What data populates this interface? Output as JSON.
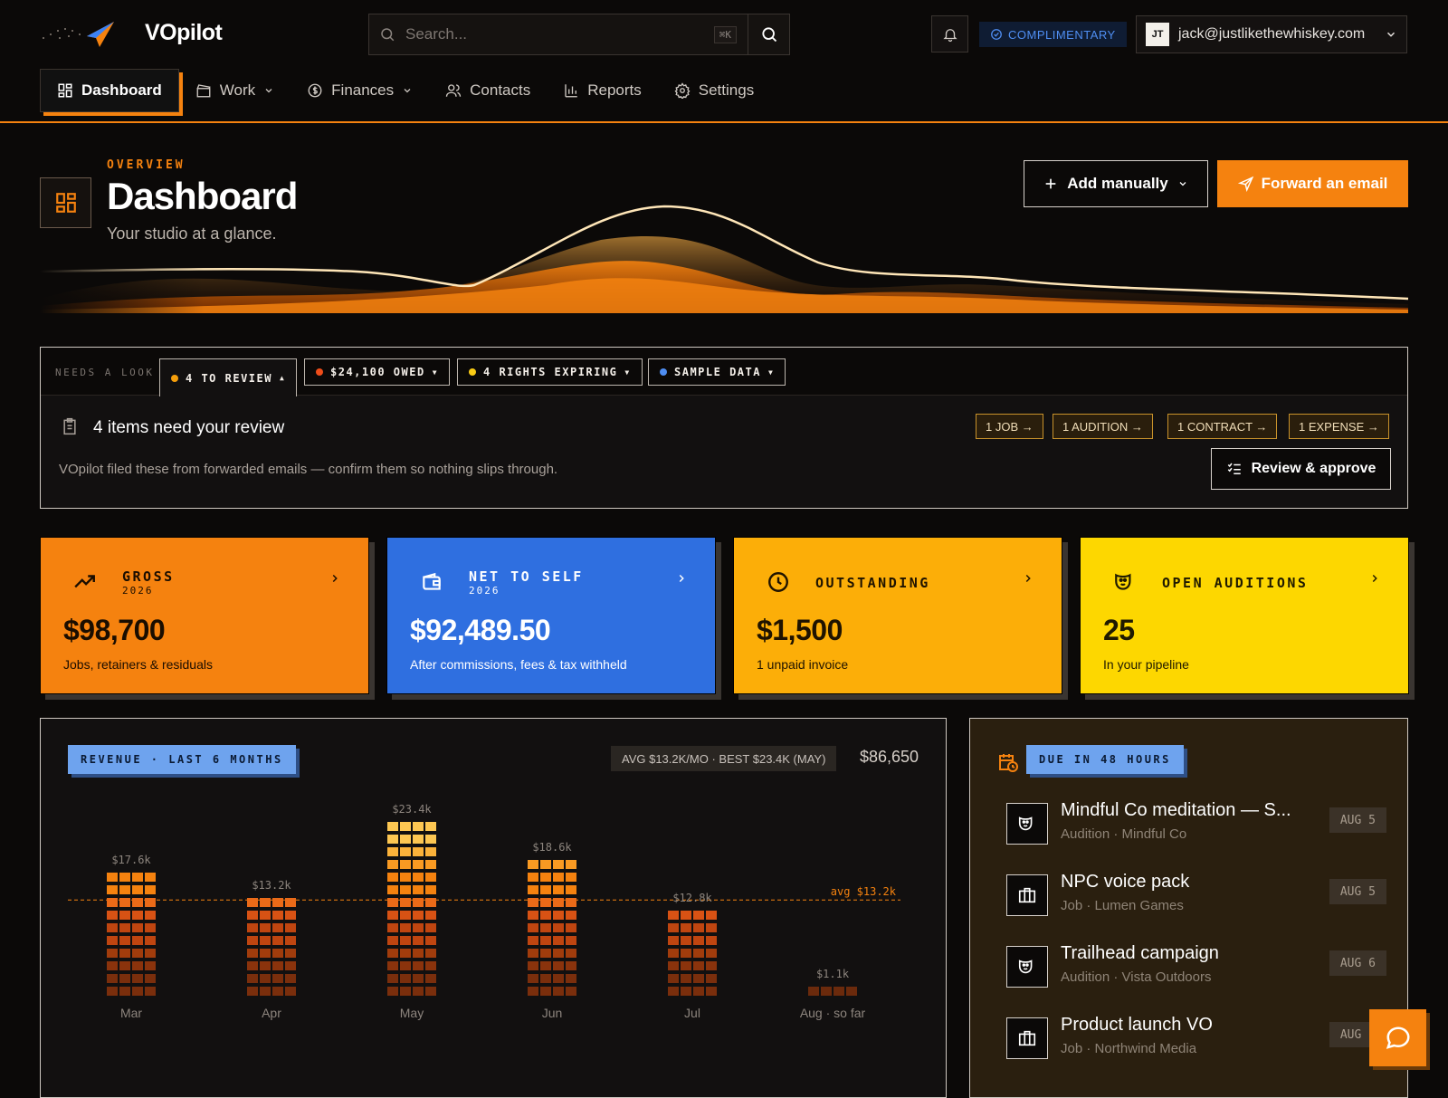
{
  "app": {
    "brand": "VOpilot"
  },
  "search": {
    "placeholder": "Search...",
    "shortcut": "⌘K"
  },
  "plan": {
    "label": "COMPLIMENTARY"
  },
  "user": {
    "initials": "JT",
    "email": "jack@justlikethewhiskey.com"
  },
  "nav": {
    "items": [
      {
        "label": "Dashboard",
        "icon": "grid-icon",
        "active": true
      },
      {
        "label": "Work",
        "icon": "clapper-icon",
        "dropdown": true
      },
      {
        "label": "Finances",
        "icon": "dollar-icon",
        "dropdown": true
      },
      {
        "label": "Contacts",
        "icon": "users-icon"
      },
      {
        "label": "Reports",
        "icon": "bar-chart-icon"
      },
      {
        "label": "Settings",
        "icon": "gear-icon"
      }
    ]
  },
  "hero": {
    "eyebrow": "OVERVIEW",
    "title": "Dashboard",
    "subtitle": "Your studio at a glance.",
    "add_label": "Add manually",
    "forward_label": "Forward an email"
  },
  "needs_look": {
    "label": "NEEDS A LOOK",
    "chips": [
      {
        "label": "4 TO REVIEW",
        "color": "#f59e0b",
        "active": true
      },
      {
        "label": "$24,100 OWED",
        "color": "#ef4d1a"
      },
      {
        "label": "4 RIGHTS EXPIRING",
        "color": "#facc15"
      },
      {
        "label": "SAMPLE DATA",
        "color": "#4f8ef2"
      }
    ],
    "title": "4 items need your review",
    "description": "VOpilot filed these from forwarded emails — confirm them so nothing slips through.",
    "tags": [
      "1 JOB →",
      "1 AUDITION →",
      "1 CONTRACT →",
      "1 EXPENSE →"
    ],
    "approve_label": "Review & approve"
  },
  "stats": [
    {
      "label": "GROSS",
      "year": "2026",
      "value": "$98,700",
      "note": "Jobs, retainers & residuals",
      "bg": "#f5820f",
      "fg": "#1a0d00",
      "icon": "trend-up-icon"
    },
    {
      "label": "NET TO SELF",
      "year": "2026",
      "value": "$92,489.50",
      "note": "After commissions, fees & tax withheld",
      "bg": "#2f6fe0",
      "fg": "#ffffff",
      "icon": "wallet-icon"
    },
    {
      "label": "OUTSTANDING",
      "year": "",
      "value": "$1,500",
      "note": "1 unpaid invoice",
      "bg": "#fcae08",
      "fg": "#1f1300",
      "icon": "clock-icon"
    },
    {
      "label": "OPEN AUDITIONS",
      "year": "",
      "value": "25",
      "note": "In your pipeline",
      "bg": "#fdd700",
      "fg": "#1f1a00",
      "icon": "masks-icon"
    }
  ],
  "revenue": {
    "badge": "REVENUE · LAST 6 MONTHS",
    "summary": "AVG $13.2K/MO · BEST $23.4K (MAY)",
    "total": "$86,650",
    "avg_label": "avg $13.2k"
  },
  "chart_data": {
    "type": "bar",
    "title": "REVENUE · LAST 6 MONTHS",
    "categories": [
      "Mar",
      "Apr",
      "May",
      "Jun",
      "Jul",
      "Aug · so far"
    ],
    "values": [
      17.6,
      13.2,
      23.4,
      18.6,
      12.8,
      1.1
    ],
    "value_labels": [
      "$17.6k",
      "$13.2k",
      "$23.4k",
      "$18.6k",
      "$12.8k",
      "$1.1k"
    ],
    "average": 13.2,
    "unit": "$k",
    "ylim": [
      0,
      24
    ]
  },
  "due": {
    "badge": "DUE IN 48 HOURS",
    "items": [
      {
        "title": "Mindful Co meditation — S...",
        "sub": "Audition · Mindful Co",
        "date": "AUG 5",
        "icon": "masks-icon"
      },
      {
        "title": "NPC voice pack",
        "sub": "Job · Lumen Games",
        "date": "AUG 5",
        "icon": "briefcase-icon"
      },
      {
        "title": "Trailhead campaign",
        "sub": "Audition · Vista Outdoors",
        "date": "AUG 6",
        "icon": "masks-icon"
      },
      {
        "title": "Product launch VO",
        "sub": "Job · Northwind Media",
        "date": "AUG 6",
        "icon": "briefcase-icon"
      }
    ]
  }
}
